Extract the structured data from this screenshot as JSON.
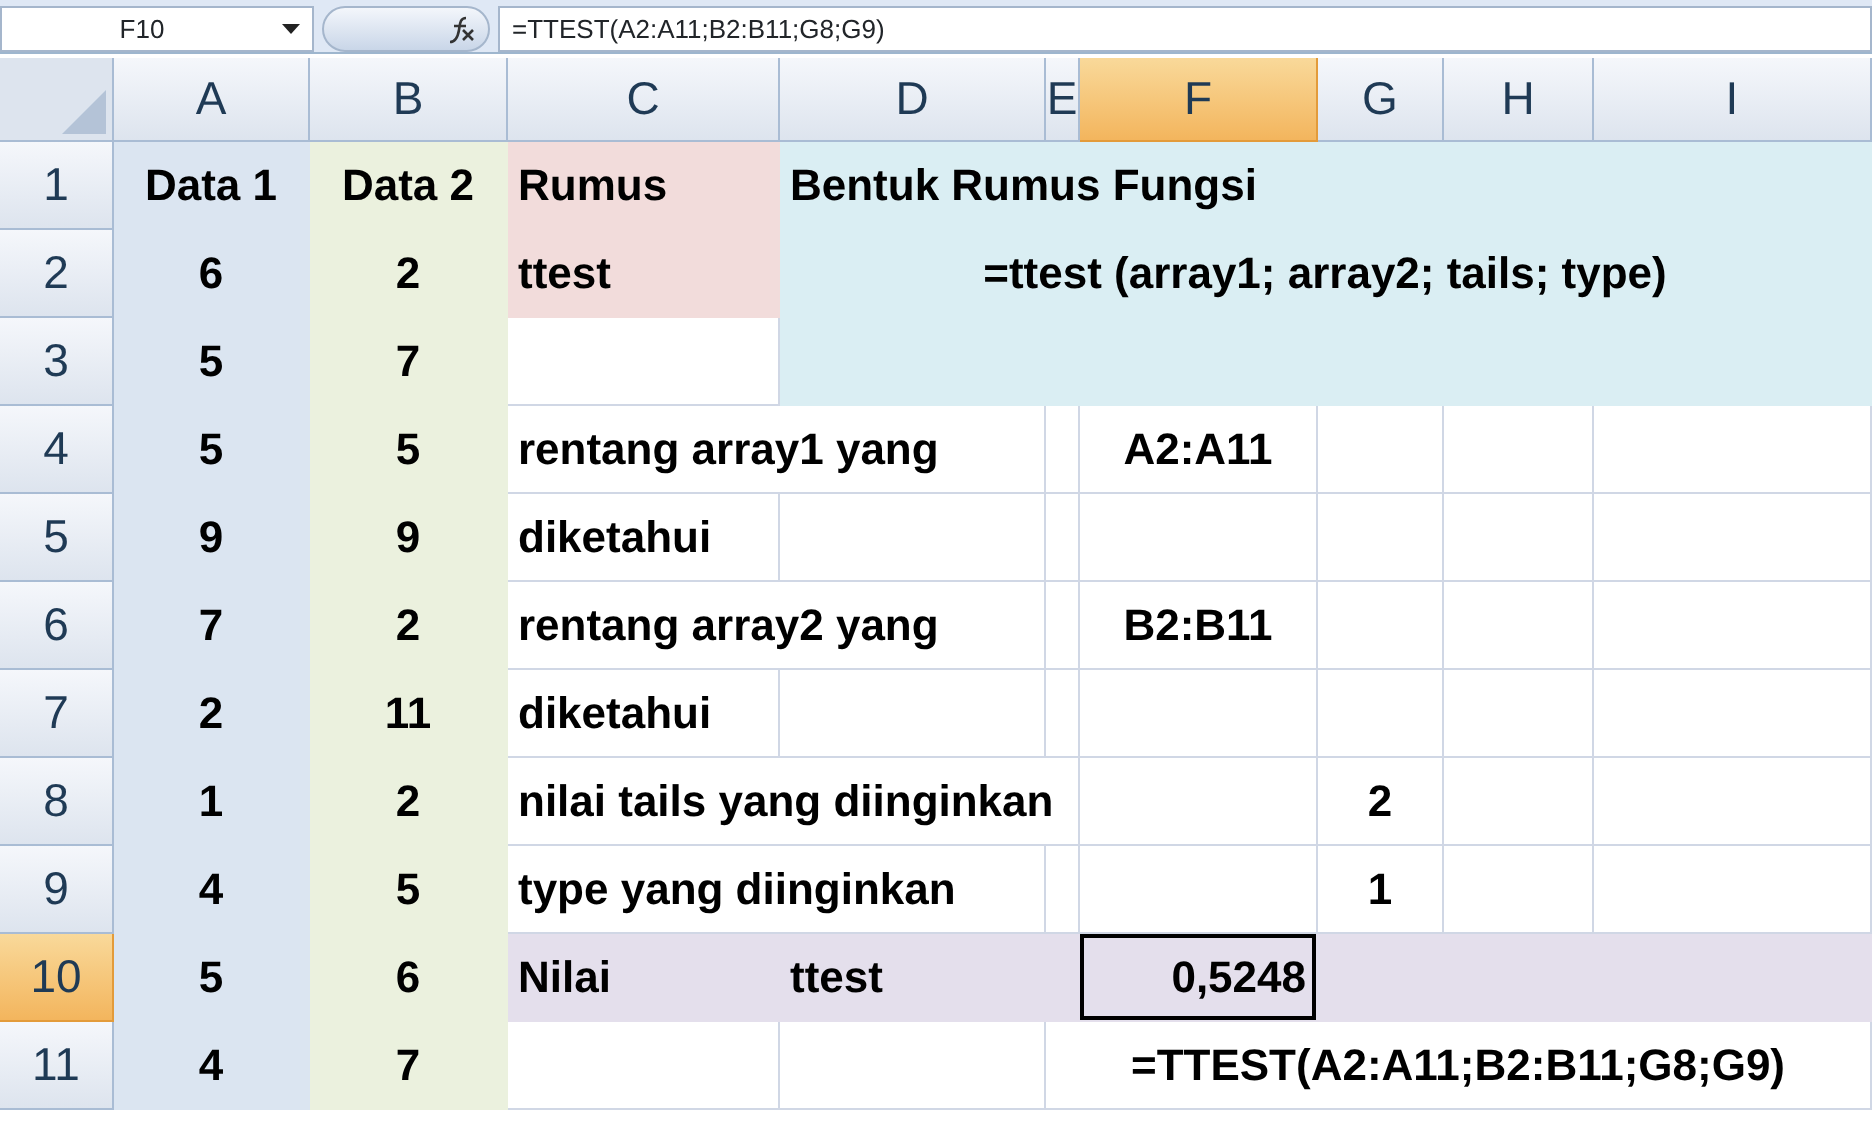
{
  "name_box": "F10",
  "formula": "=TTEST(A2:A11;B2:B11;G8;G9)",
  "columns": [
    {
      "label": "A",
      "selected": false
    },
    {
      "label": "B",
      "selected": false
    },
    {
      "label": "C",
      "selected": false
    },
    {
      "label": "D",
      "selected": false
    },
    {
      "label": "E",
      "selected": false
    },
    {
      "label": "F",
      "selected": true
    },
    {
      "label": "G",
      "selected": false
    },
    {
      "label": "H",
      "selected": false
    },
    {
      "label": "I",
      "selected": false
    }
  ],
  "rows": [
    {
      "label": "1",
      "selected": false,
      "cells": [
        {
          "text": "Data 1",
          "kind": "number",
          "color": "#dbe5f1"
        },
        {
          "text": "Data 2",
          "kind": "number",
          "color": "#ebf1de"
        },
        {
          "text": "Rumus",
          "kind": "text",
          "color": "#f2dcdb"
        },
        {
          "text": "Bentuk Rumus Fungsi",
          "kind": "text",
          "color": "#daeef3"
        },
        {
          "color": "#daeef3"
        },
        {
          "color": "#daeef3"
        },
        {
          "color": "#daeef3"
        },
        {
          "color": "#daeef3"
        },
        {
          "color": "#daeef3"
        }
      ]
    },
    {
      "label": "2",
      "selected": false,
      "cells": [
        {
          "text": "6",
          "kind": "number",
          "color": "#dbe5f1"
        },
        {
          "text": "2",
          "kind": "number",
          "color": "#ebf1de"
        },
        {
          "text": "ttest",
          "kind": "text",
          "color": "#f2dcdb"
        },
        {
          "text": "=ttest  (array1; array2; tails; type)",
          "kind": "formula",
          "color": "#daeef3"
        },
        {
          "color": "#daeef3"
        },
        {
          "color": "#daeef3"
        },
        {
          "color": "#daeef3"
        },
        {
          "color": "#daeef3"
        },
        {
          "color": "#daeef3"
        }
      ]
    },
    {
      "label": "3",
      "selected": false,
      "cells": [
        {
          "text": "5",
          "kind": "number",
          "color": "#dbe5f1"
        },
        {
          "text": "7",
          "kind": "number",
          "color": "#ebf1de"
        },
        {},
        {
          "color": "#daeef3"
        },
        {
          "color": "#daeef3"
        },
        {
          "color": "#daeef3"
        },
        {
          "color": "#daeef3"
        },
        {
          "color": "#daeef3"
        },
        {
          "color": "#daeef3"
        }
      ]
    },
    {
      "label": "4",
      "selected": false,
      "cells": [
        {
          "text": "5",
          "kind": "number",
          "color": "#dbe5f1"
        },
        {
          "text": "5",
          "kind": "number",
          "color": "#ebf1de"
        },
        {
          "text": "rentang array1 yang",
          "kind": "text"
        },
        {},
        {},
        {
          "text": "A2:A11",
          "kind": "reference"
        },
        {},
        {},
        {}
      ]
    },
    {
      "label": "5",
      "selected": false,
      "cells": [
        {
          "text": "9",
          "kind": "number",
          "color": "#dbe5f1"
        },
        {
          "text": "9",
          "kind": "number",
          "color": "#ebf1de"
        },
        {
          "text": "diketahui",
          "kind": "text"
        },
        {},
        {},
        {},
        {},
        {},
        {}
      ]
    },
    {
      "label": "6",
      "selected": false,
      "cells": [
        {
          "text": "7",
          "kind": "number",
          "color": "#dbe5f1"
        },
        {
          "text": "2",
          "kind": "number",
          "color": "#ebf1de"
        },
        {
          "text": "rentang array2 yang",
          "kind": "text"
        },
        {},
        {},
        {
          "text": "B2:B11",
          "kind": "reference"
        },
        {},
        {},
        {}
      ]
    },
    {
      "label": "7",
      "selected": false,
      "cells": [
        {
          "text": "2",
          "kind": "number",
          "color": "#dbe5f1"
        },
        {
          "text": "11",
          "kind": "number",
          "color": "#ebf1de"
        },
        {
          "text": "diketahui",
          "kind": "text"
        },
        {},
        {},
        {},
        {},
        {},
        {}
      ]
    },
    {
      "label": "8",
      "selected": false,
      "cells": [
        {
          "text": "1",
          "kind": "number",
          "color": "#dbe5f1"
        },
        {
          "text": "2",
          "kind": "number",
          "color": "#ebf1de"
        },
        {
          "text": "nilai tails yang diinginkan",
          "kind": "text"
        },
        {},
        {},
        {},
        {
          "text": "2",
          "kind": "number"
        },
        {},
        {}
      ]
    },
    {
      "label": "9",
      "selected": false,
      "cells": [
        {
          "text": "4",
          "kind": "number",
          "color": "#dbe5f1"
        },
        {
          "text": "5",
          "kind": "number",
          "color": "#ebf1de"
        },
        {
          "text": "type yang diinginkan",
          "kind": "text"
        },
        {},
        {},
        {},
        {
          "text": "1",
          "kind": "number"
        },
        {},
        {}
      ]
    },
    {
      "label": "10",
      "selected": true,
      "cells": [
        {
          "text": "5",
          "kind": "number",
          "color": "#dbe5f1"
        },
        {
          "text": "6",
          "kind": "number",
          "color": "#ebf1de"
        },
        {
          "text": "Nilai",
          "kind": "text",
          "color": "#e4dfec"
        },
        {
          "text": "ttest",
          "kind": "text",
          "color": "#e4dfec"
        },
        {
          "color": "#e4dfec"
        },
        {
          "text": "0,5248",
          "kind": "result",
          "color": "#e4dfec",
          "active": true
        },
        {
          "color": "#e4dfec"
        },
        {
          "color": "#e4dfec"
        },
        {
          "color": "#e4dfec"
        }
      ]
    },
    {
      "label": "11",
      "selected": false,
      "cells": [
        {
          "text": "4",
          "kind": "number",
          "color": "#dbe5f1"
        },
        {
          "text": "7",
          "kind": "number",
          "color": "#ebf1de"
        },
        {},
        {},
        {
          "text": "=TTEST(A2:A11;B2:B11;G8;G9)",
          "kind": "formula"
        },
        {},
        {},
        {},
        {}
      ]
    }
  ]
}
